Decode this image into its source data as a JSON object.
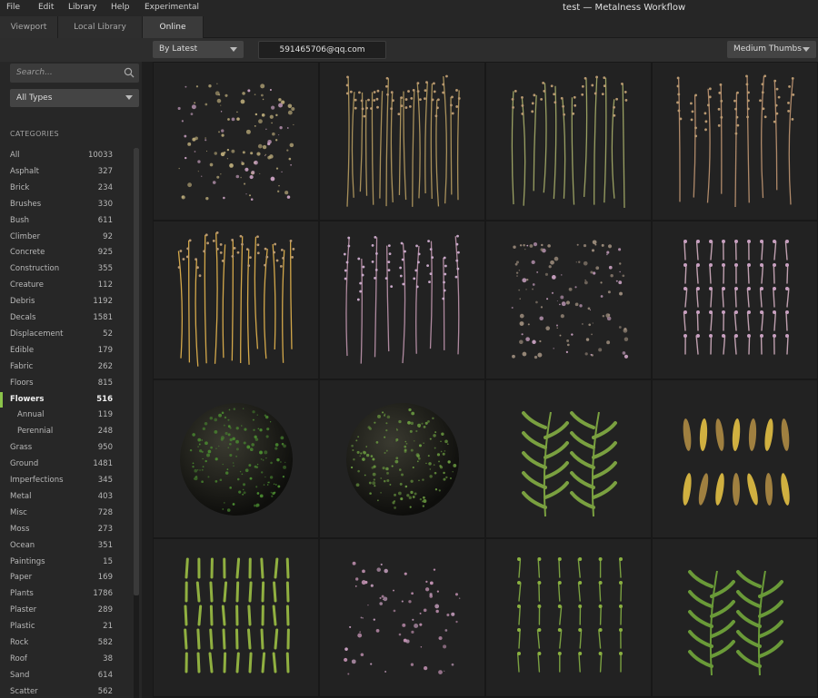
{
  "menubar": {
    "items": [
      "File",
      "Edit",
      "Library",
      "Help",
      "Experimental"
    ],
    "title": "test — Metalness Workflow"
  },
  "tabs": [
    {
      "label": "Viewport",
      "active": false
    },
    {
      "label": "Local Library",
      "active": false
    },
    {
      "label": "Online",
      "active": true
    }
  ],
  "toolbar": {
    "sort_label": "By Latest",
    "account": "591465706@qq.com",
    "thumb_size": "Medium Thumbs"
  },
  "sidebar": {
    "search_placeholder": "Search...",
    "type_filter": "All Types",
    "categories_header": "CATEGORIES",
    "categories": [
      {
        "label": "All",
        "count": "10033"
      },
      {
        "label": "Asphalt",
        "count": "327"
      },
      {
        "label": "Brick",
        "count": "234"
      },
      {
        "label": "Brushes",
        "count": "330"
      },
      {
        "label": "Bush",
        "count": "611"
      },
      {
        "label": "Climber",
        "count": "92"
      },
      {
        "label": "Concrete",
        "count": "925"
      },
      {
        "label": "Construction",
        "count": "355"
      },
      {
        "label": "Creature",
        "count": "112"
      },
      {
        "label": "Debris",
        "count": "1192"
      },
      {
        "label": "Decals",
        "count": "1581"
      },
      {
        "label": "Displacement",
        "count": "52"
      },
      {
        "label": "Edible",
        "count": "179"
      },
      {
        "label": "Fabric",
        "count": "262"
      },
      {
        "label": "Floors",
        "count": "815"
      },
      {
        "label": "Flowers",
        "count": "516",
        "active": true
      },
      {
        "label": "Annual",
        "count": "119",
        "sub": true
      },
      {
        "label": "Perennial",
        "count": "248",
        "sub": true
      },
      {
        "label": "Grass",
        "count": "950"
      },
      {
        "label": "Ground",
        "count": "1481"
      },
      {
        "label": "Imperfections",
        "count": "345"
      },
      {
        "label": "Metal",
        "count": "403"
      },
      {
        "label": "Misc",
        "count": "728"
      },
      {
        "label": "Moss",
        "count": "273"
      },
      {
        "label": "Ocean",
        "count": "351"
      },
      {
        "label": "Paintings",
        "count": "15"
      },
      {
        "label": "Paper",
        "count": "169"
      },
      {
        "label": "Plants",
        "count": "1786"
      },
      {
        "label": "Plaster",
        "count": "289"
      },
      {
        "label": "Plastic",
        "count": "21"
      },
      {
        "label": "Rock",
        "count": "582"
      },
      {
        "label": "Roof",
        "count": "38"
      },
      {
        "label": "Sand",
        "count": "614"
      },
      {
        "label": "Scatter",
        "count": "562"
      }
    ]
  },
  "assets": [
    {
      "kind": "scatter-debris",
      "color": "#b8a878"
    },
    {
      "kind": "tall-stems",
      "color": "#a8905a"
    },
    {
      "kind": "sprigs",
      "color": "#9aa062"
    },
    {
      "kind": "tall-flowers",
      "color": "#b08a6a"
    },
    {
      "kind": "golden-stems",
      "color": "#d4a84a"
    },
    {
      "kind": "lavender-sprigs",
      "color": "#b08aa0"
    },
    {
      "kind": "scatter-debris",
      "color": "#9a8a7a"
    },
    {
      "kind": "lavender-rows",
      "color": "#c0a0b0"
    },
    {
      "kind": "moss-sphere",
      "color": "#4a8a30"
    },
    {
      "kind": "moss-sphere",
      "color": "#6a9a40"
    },
    {
      "kind": "wild-plant",
      "color": "#7aa040"
    },
    {
      "kind": "dried-petals",
      "color": "#d0b040"
    },
    {
      "kind": "leaf-rows",
      "color": "#90b040"
    },
    {
      "kind": "flower-heads",
      "color": "#c090b0"
    },
    {
      "kind": "seedlings",
      "color": "#7aa040"
    },
    {
      "kind": "wild-plant",
      "color": "#6a9a38"
    }
  ]
}
